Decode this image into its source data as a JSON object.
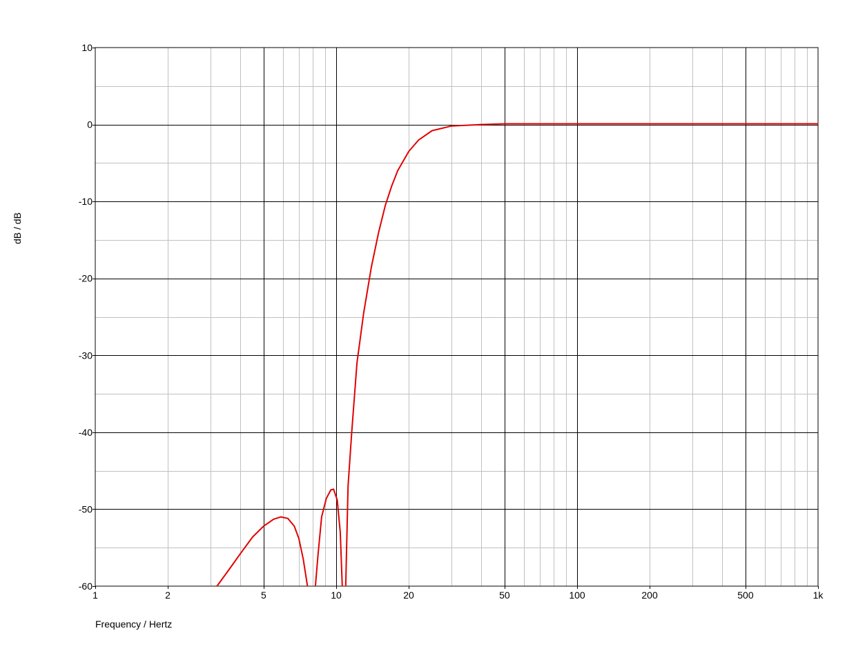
{
  "chart_data": {
    "type": "line",
    "xscale": "log",
    "xlim": [
      1,
      1000
    ],
    "ylim": [
      -60,
      10
    ],
    "xlabel": "Frequency / Hertz",
    "ylabel": "dB / dB",
    "grid": true,
    "x_ticks": [
      {
        "value": 1,
        "label": "1"
      },
      {
        "value": 2,
        "label": "2"
      },
      {
        "value": 5,
        "label": "5"
      },
      {
        "value": 10,
        "label": "10"
      },
      {
        "value": 20,
        "label": "20"
      },
      {
        "value": 50,
        "label": "50"
      },
      {
        "value": 100,
        "label": "100"
      },
      {
        "value": 200,
        "label": "200"
      },
      {
        "value": 500,
        "label": "500"
      },
      {
        "value": 1000,
        "label": "1k"
      }
    ],
    "y_ticks": [
      {
        "value": 10,
        "label": "10"
      },
      {
        "value": 0,
        "label": "0"
      },
      {
        "value": -10,
        "label": "-10"
      },
      {
        "value": -20,
        "label": "-20"
      },
      {
        "value": -30,
        "label": "-30"
      },
      {
        "value": -40,
        "label": "-40"
      },
      {
        "value": -50,
        "label": "-50"
      },
      {
        "value": -60,
        "label": "-60"
      }
    ],
    "series": [
      {
        "color": "#e00000",
        "segments": [
          [
            [
              3.2,
              -60
            ],
            [
              3.6,
              -57.8
            ],
            [
              4.0,
              -55.8
            ],
            [
              4.5,
              -53.6
            ],
            [
              5.0,
              -52.2
            ],
            [
              5.5,
              -51.3
            ],
            [
              5.9,
              -51.0
            ],
            [
              6.3,
              -51.2
            ],
            [
              6.7,
              -52.2
            ],
            [
              7.0,
              -53.8
            ],
            [
              7.3,
              -56.5
            ],
            [
              7.6,
              -60
            ]
          ],
          [
            [
              8.2,
              -60
            ],
            [
              8.4,
              -56.0
            ],
            [
              8.7,
              -51.0
            ],
            [
              9.1,
              -48.6
            ],
            [
              9.5,
              -47.5
            ],
            [
              9.75,
              -47.4
            ],
            [
              10.1,
              -48.8
            ],
            [
              10.4,
              -53.0
            ],
            [
              10.6,
              -60
            ]
          ],
          [
            [
              10.95,
              -60
            ],
            [
              11.2,
              -47
            ],
            [
              11.6,
              -40
            ],
            [
              12.2,
              -31
            ],
            [
              13.0,
              -24.5
            ],
            [
              14.0,
              -18.5
            ],
            [
              15.0,
              -14.0
            ],
            [
              16.0,
              -10.5
            ],
            [
              17.0,
              -8.0
            ],
            [
              18.0,
              -6.0
            ],
            [
              20.0,
              -3.5
            ],
            [
              22.0,
              -2.0
            ],
            [
              25.0,
              -0.8
            ],
            [
              30.0,
              -0.2
            ],
            [
              40.0,
              0.0
            ],
            [
              50.0,
              0.1
            ],
            [
              100.0,
              0.1
            ],
            [
              1000.0,
              0.1
            ]
          ]
        ]
      }
    ]
  }
}
